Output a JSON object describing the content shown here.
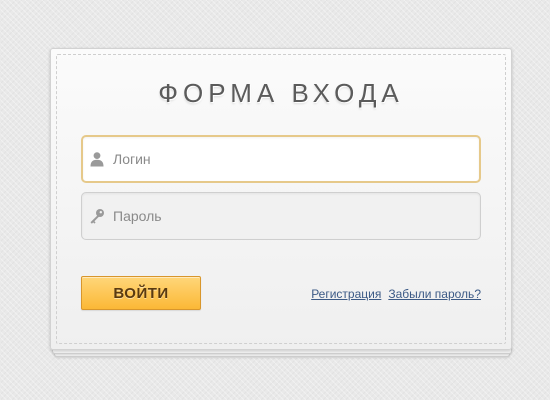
{
  "form": {
    "title": "ФОРМА ВХОДА",
    "login": {
      "value": "",
      "placeholder": "Логин",
      "icon": "user-icon"
    },
    "password": {
      "value": "",
      "placeholder": "Пароль",
      "icon": "key-icon"
    },
    "submit_label": "ВОЙТИ",
    "links": {
      "register": "Регистрация",
      "forgot": "Забыли пароль?"
    }
  },
  "colors": {
    "background": "#e9e9e9",
    "accent": "#fbb836",
    "active_field_border": "#e6c98a",
    "link": "#3c5a86",
    "title": "#5b5b5b"
  }
}
